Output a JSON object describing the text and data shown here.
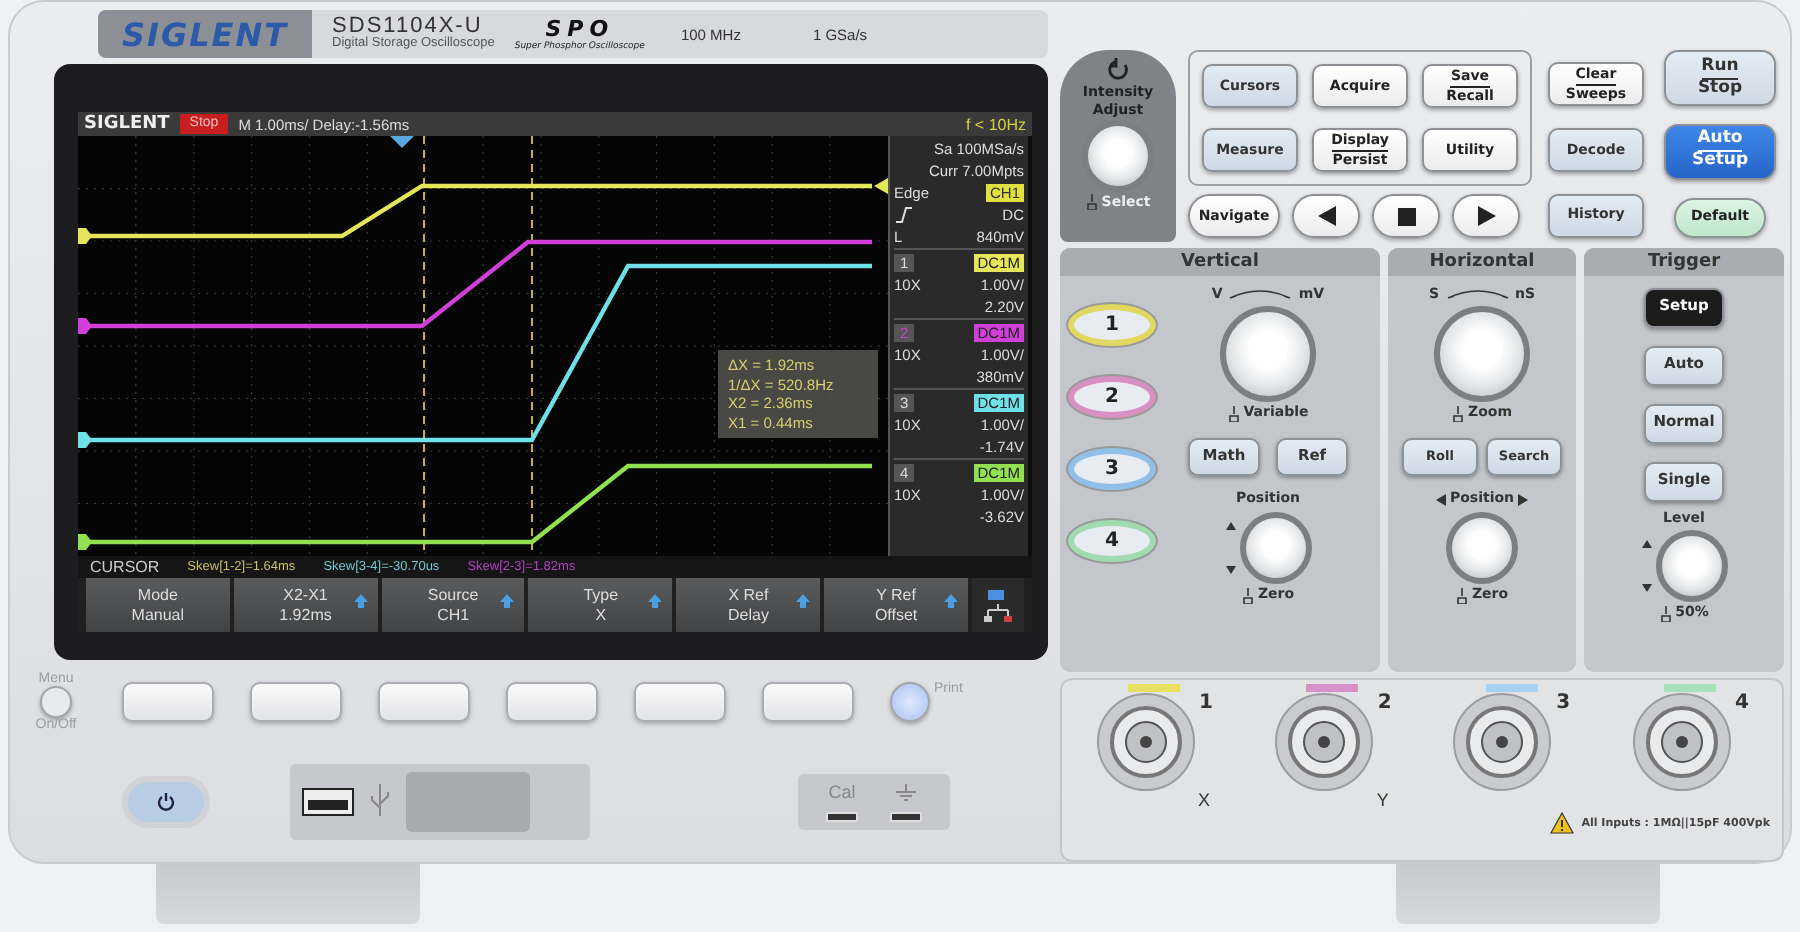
{
  "header": {
    "logo": "SIGLENT",
    "model": "SDS1104X-U",
    "subtitle": "Digital Storage Oscilloscope",
    "series_logo": "SPO",
    "series_name": "Super Phosphor Oscilloscope",
    "bandwidth": "100 MHz",
    "sample_rate": "1 GSa/s"
  },
  "screen": {
    "logo": "SIGLENT",
    "run_state": "Stop",
    "timebase": "M 1.00ms/ Delay:-1.56ms",
    "trigger_frequency": "f < 10Hz",
    "sample_rate": "Sa 100MSa/s",
    "memory_depth": "Curr 7.00Mpts",
    "trigger": {
      "type": "Edge",
      "source": "CH1",
      "coupling": "DC",
      "level_label": "L",
      "level_value": "840mV"
    },
    "channels": [
      {
        "number": "1",
        "probe": "10X",
        "coupling": "DC1M",
        "scale": "1.00V/",
        "offset": "2.20V",
        "color": "#e6e65a"
      },
      {
        "number": "2",
        "probe": "10X",
        "coupling": "DC1M",
        "scale": "1.00V/",
        "offset": "380mV",
        "color": "#d040d8"
      },
      {
        "number": "3",
        "probe": "10X",
        "coupling": "DC1M",
        "scale": "1.00V/",
        "offset": "-1.74V",
        "color": "#70e0e8"
      },
      {
        "number": "4",
        "probe": "10X",
        "coupling": "DC1M",
        "scale": "1.00V/",
        "offset": "-3.62V",
        "color": "#90e050"
      }
    ],
    "cursor_readout": [
      "ΔX = 1.92ms",
      "1/ΔX = 520.8Hz",
      "X2 = 2.36ms",
      "X1 = 0.44ms"
    ],
    "menu_title": "CURSOR",
    "skews": [
      {
        "text": "Skew[1-2]=1.64ms",
        "color": "#c8c060"
      },
      {
        "text": "Skew[3-4]=-30.70us",
        "color": "#70c8d0"
      },
      {
        "text": "Skew[2-3]=1.82ms",
        "color": "#b040c0"
      }
    ],
    "softmenu": [
      {
        "label": "Mode",
        "value": "Manual",
        "adjustable": false
      },
      {
        "label": "X2-X1",
        "value": "1.92ms",
        "adjustable": true
      },
      {
        "label": "Source",
        "value": "CH1",
        "adjustable": true
      },
      {
        "label": "Type",
        "value": "X",
        "adjustable": true
      },
      {
        "label": "X Ref",
        "value": "Delay",
        "adjustable": true
      },
      {
        "label": "Y Ref",
        "value": "Offset",
        "adjustable": true
      }
    ]
  },
  "side_buttons": {
    "menu": "Menu",
    "on_off": "On/Off",
    "print": "Print"
  },
  "panel": {
    "intensity": {
      "title": "Intensity",
      "subtitle": "Adjust",
      "push_label": "Select"
    },
    "menu_buttons": [
      {
        "lines": [
          "Cursors"
        ],
        "kind": "tinted"
      },
      {
        "lines": [
          "Acquire"
        ],
        "kind": "white"
      },
      {
        "lines": [
          "Save",
          "Recall"
        ],
        "kind": "white"
      },
      {
        "lines": [
          "Measure"
        ],
        "kind": "tinted"
      },
      {
        "lines": [
          "Display",
          "Persist"
        ],
        "kind": "white"
      },
      {
        "lines": [
          "Utility"
        ],
        "kind": "white"
      }
    ],
    "navigate": "Navigate",
    "mode_buttons": [
      {
        "lines": [
          "Clear",
          "Sweeps"
        ],
        "kind": "white"
      },
      {
        "lines": [
          "Decode"
        ],
        "kind": "tinted"
      },
      {
        "lines": [
          "History"
        ],
        "kind": "tinted"
      }
    ],
    "action_buttons": [
      {
        "lines": [
          "Run",
          "Stop"
        ],
        "kind": "tinted"
      },
      {
        "lines": [
          "Auto",
          "Setup"
        ],
        "kind": "blue"
      },
      {
        "lines": [
          "Default"
        ],
        "kind": "green"
      }
    ],
    "vertical": {
      "title": "Vertical",
      "channel_buttons": [
        {
          "label": "1",
          "color": "#e0d860"
        },
        {
          "label": "2",
          "color": "#d890c0"
        },
        {
          "label": "3",
          "color": "#90c0e8"
        },
        {
          "label": "4",
          "color": "#a0dcb0"
        }
      ],
      "scale_left": "V",
      "scale_right": "mV",
      "scale_push": "Variable",
      "buttons": [
        "Math",
        "Ref"
      ],
      "position": "Position",
      "position_push": "Zero"
    },
    "horizontal": {
      "title": "Horizontal",
      "scale_left": "S",
      "scale_right": "nS",
      "scale_push": "Zoom",
      "buttons": [
        "Roll",
        "Search"
      ],
      "position": "Position",
      "position_push": "Zero"
    },
    "trigger": {
      "title": "Trigger",
      "buttons": [
        {
          "label": "Setup",
          "selected": true
        },
        {
          "label": "Auto",
          "selected": false
        },
        {
          "label": "Normal",
          "selected": false
        },
        {
          "label": "Single",
          "selected": false
        }
      ],
      "level_label": "Level",
      "level_push": "50%"
    }
  },
  "inputs": {
    "connectors": [
      {
        "number": "1",
        "axis": "X",
        "color": "#e8e060"
      },
      {
        "number": "2",
        "axis": "Y",
        "color": "#d890c8"
      },
      {
        "number": "3",
        "color": "#a8d0f0"
      },
      {
        "number": "4",
        "color": "#a8e0b8"
      }
    ],
    "note": "All Inputs : 1MΩ||15pF  400Vpk"
  },
  "cal": "Cal"
}
